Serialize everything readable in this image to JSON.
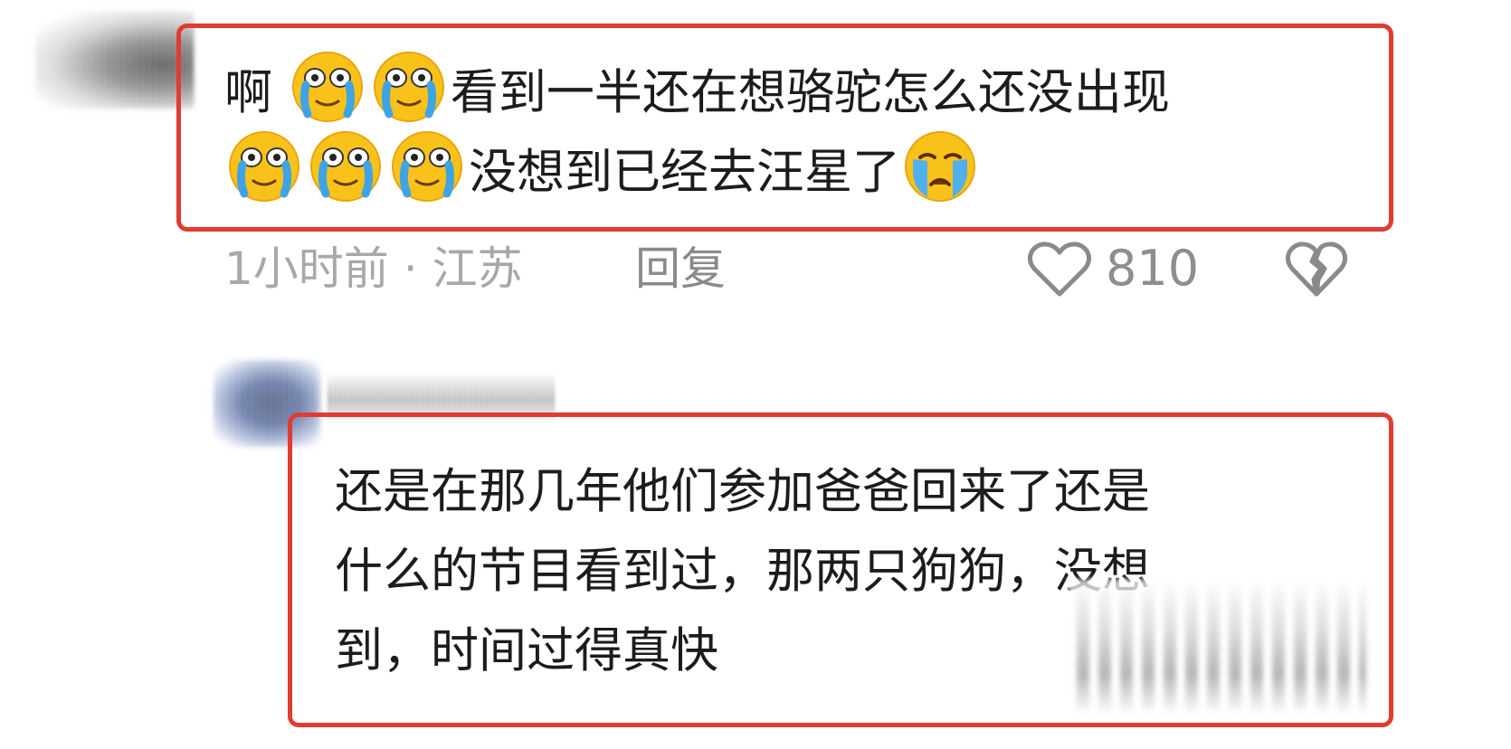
{
  "comment1": {
    "line1_prefix": "啊",
    "line1_text": "看到一半还在想骆驼怎么还没出现",
    "line2_text": "没想到已经去汪星了",
    "emojis": [
      "crying-laugh-emoji",
      "crying-laugh-emoji",
      "crying-laugh-emoji",
      "crying-laugh-emoji",
      "crying-laugh-emoji",
      "loudly-crying-emoji"
    ],
    "time_location": "1小时前 · 江苏",
    "reply_label": "回复",
    "like_count": "810"
  },
  "comment2": {
    "line1": "还是在那几年他们参加爸爸回来了还是",
    "line2": "什么的节目看到过，那两只狗狗，没想",
    "line3": "到，时间过得真快"
  },
  "colors": {
    "highlight_border": "#e23b30",
    "meta_text": "#a8a8a8"
  }
}
